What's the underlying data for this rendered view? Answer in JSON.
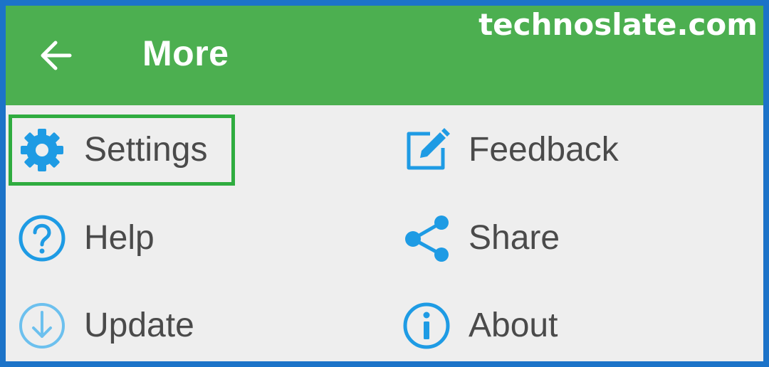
{
  "watermark": "technoslate.com",
  "appbar": {
    "title": "More",
    "back_icon": "arrow-back-icon",
    "color": "#4caf50"
  },
  "menu": {
    "accent_color": "#1e9be4",
    "highlight_color": "#2fac3f",
    "items": [
      {
        "label": "Settings",
        "icon": "gear-icon",
        "highlighted": true
      },
      {
        "label": "Feedback",
        "icon": "edit-icon"
      },
      {
        "label": "Help",
        "icon": "help-icon"
      },
      {
        "label": "Share",
        "icon": "share-icon"
      },
      {
        "label": "Update",
        "icon": "download-icon"
      },
      {
        "label": "About",
        "icon": "info-icon"
      }
    ]
  }
}
